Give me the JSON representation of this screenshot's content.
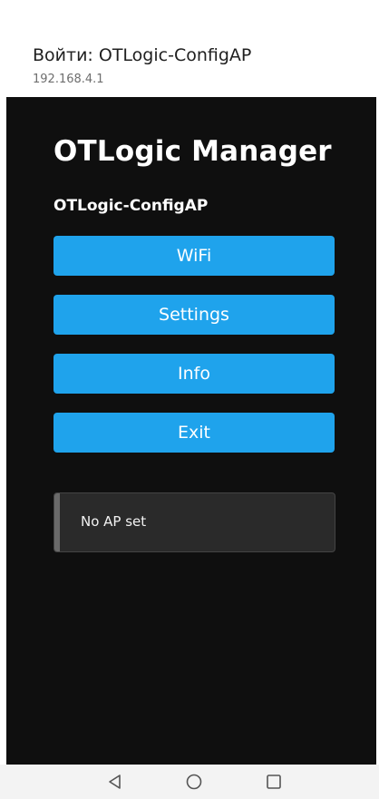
{
  "header": {
    "title": "Войти: OTLogic-ConfigAP",
    "url": "192.168.4.1"
  },
  "page": {
    "title": "OTLogic Manager",
    "ap_name": "OTLogic-ConfigAP"
  },
  "buttons": {
    "wifi": "WiFi",
    "settings": "Settings",
    "info": "Info",
    "exit": "Exit"
  },
  "message": {
    "text": "No AP set"
  },
  "nav": {
    "icons": [
      "back-icon",
      "home-icon",
      "recent-apps-icon"
    ]
  },
  "colors": {
    "button": "#1fa3ec",
    "background": "#0f0f0f",
    "message_box": "#2a2a2a"
  }
}
